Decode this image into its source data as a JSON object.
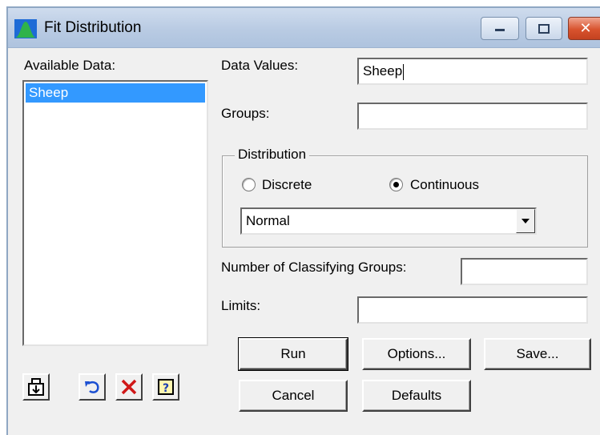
{
  "window": {
    "title": "Fit Distribution"
  },
  "titlebar": {
    "close_glyph": "✕"
  },
  "available_data": {
    "label": "Available Data:",
    "items": [
      "Sheep"
    ]
  },
  "data_values": {
    "label": "Data Values:",
    "value": "Sheep"
  },
  "groups": {
    "label": "Groups:",
    "value": ""
  },
  "distribution": {
    "legend": "Distribution",
    "discrete_label": "Discrete",
    "continuous_label": "Continuous",
    "selected": "Continuous",
    "type_value": "Normal"
  },
  "classifying_groups": {
    "label": "Number of Classifying Groups:",
    "value": ""
  },
  "limits": {
    "label": "Limits:",
    "value": ""
  },
  "buttons": {
    "run": "Run",
    "options": "Options...",
    "save": "Save...",
    "cancel": "Cancel",
    "defaults": "Defaults"
  },
  "toolbar": {
    "help_glyph": "?"
  }
}
